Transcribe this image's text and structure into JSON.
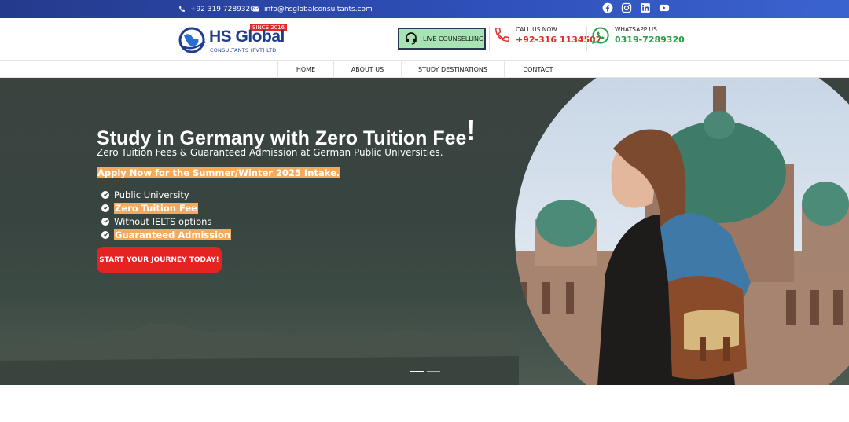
{
  "topbar": {
    "phone": "+92 319 7289320",
    "email": "info@hsglobalconsultants.com",
    "socials": [
      "facebook-icon",
      "instagram-icon",
      "linkedin-icon",
      "youtube-icon"
    ]
  },
  "header": {
    "logo": {
      "since": "SINCE 2016",
      "name": "HS Global",
      "sub": "CONSULTANTS (PVT) LTD"
    },
    "live_counselling": "LIVE COUNSELLING",
    "call": {
      "label": "CALL US NOW",
      "number": "+92-316 1134507"
    },
    "whatsapp": {
      "label": "WHATSAPP US",
      "number": "0319-7289320"
    }
  },
  "nav": {
    "items": [
      "HOME",
      "ABOUT US",
      "STUDY DESTINATIONS",
      "CONTACT"
    ]
  },
  "hero": {
    "title": "Study in Germany with Zero Tuition Fee",
    "title_bang": "!",
    "subtitle": "Zero Tuition Fees & Guaranteed Admission at German Public Universities.",
    "intake": "Apply Now for the Summer/Winter 2025 Intake.",
    "features": [
      "Public University",
      "Zero Tuition Fee",
      "Without IELTS options",
      "Guaranteed Admission"
    ],
    "cta": "START YOUR JOURNEY TODAY!"
  },
  "colors": {
    "brand_blue": "#1f3d8f",
    "accent_red": "#e52421",
    "highlight_orange": "#f7a95a",
    "whatsapp_green": "#25a244",
    "live_button_bg": "#a8e3b4"
  }
}
